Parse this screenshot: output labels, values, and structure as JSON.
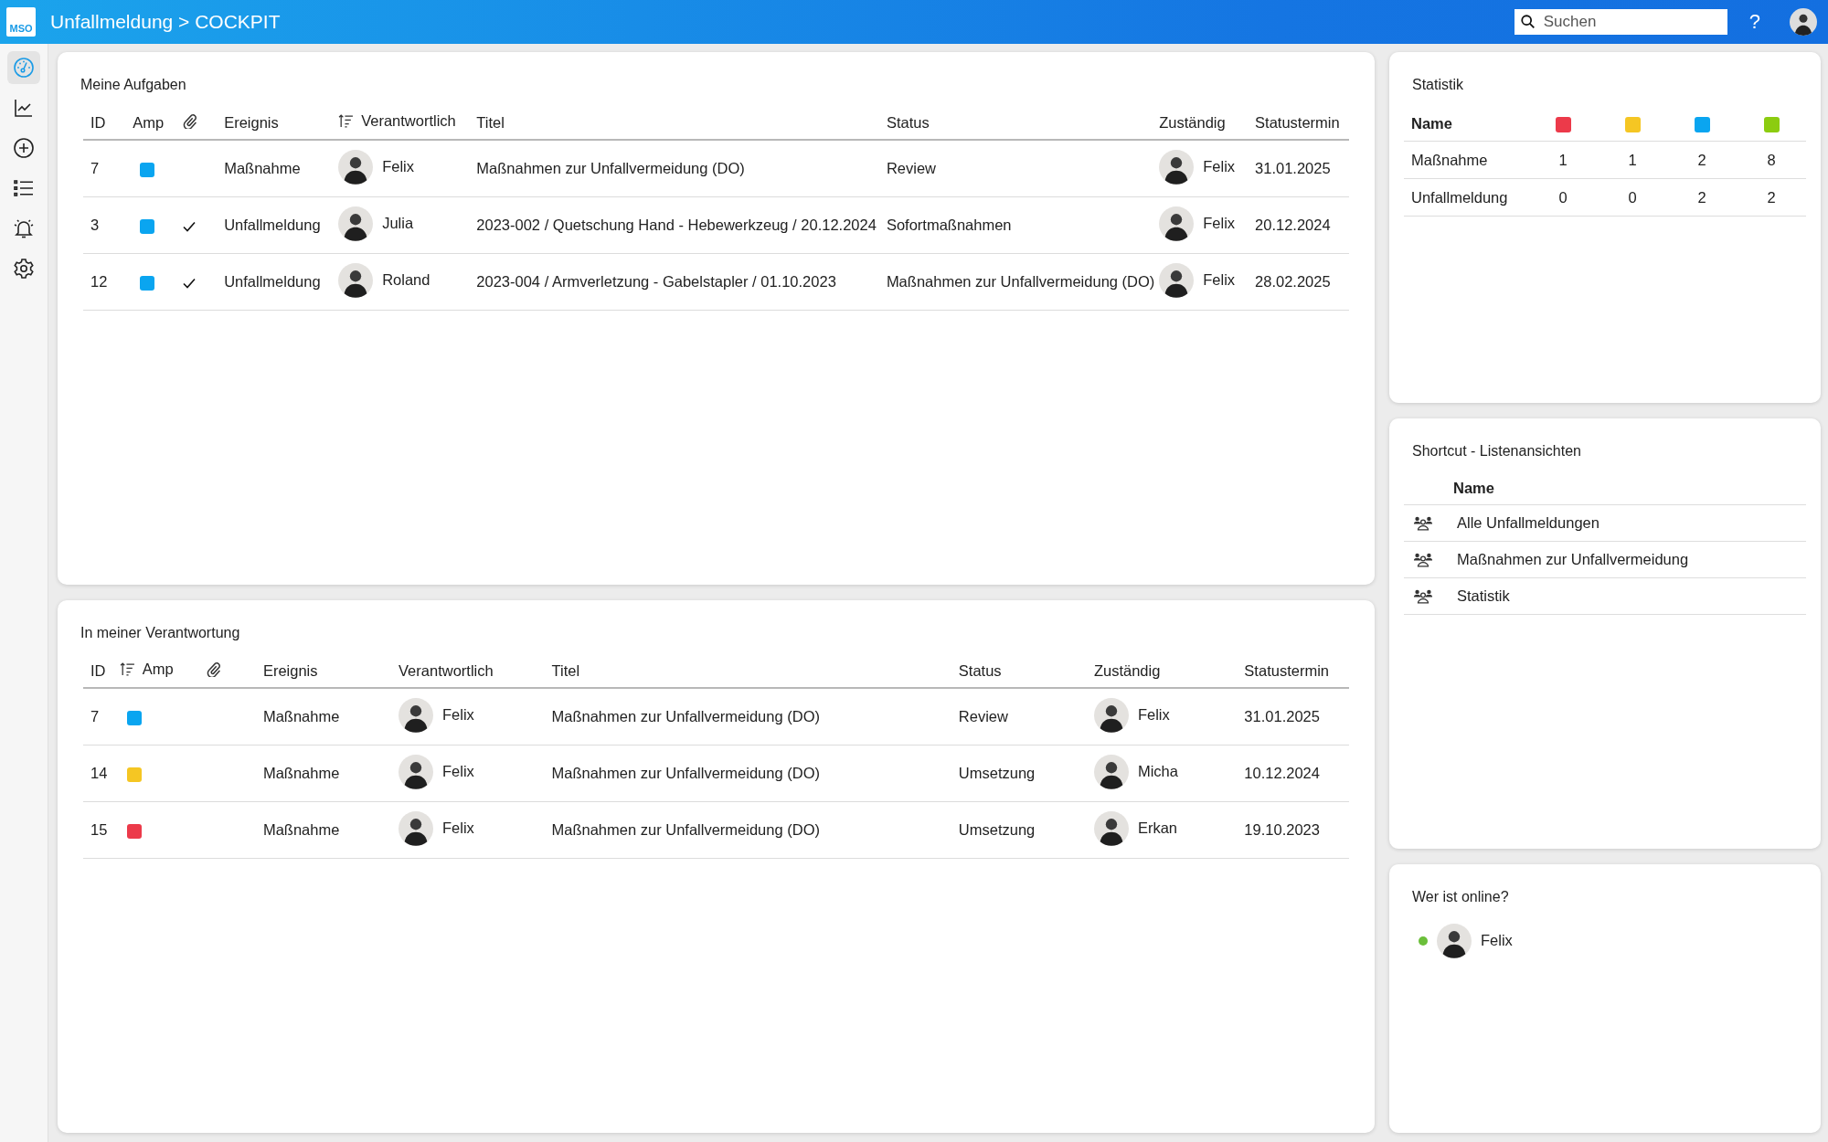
{
  "header": {
    "logo": "MSO",
    "title": "Unfallmeldung > COCKPIT",
    "search": {
      "placeholder": "Suchen"
    },
    "help": "?"
  },
  "sidebar": {
    "items": [
      {
        "kind": "gauge",
        "selected": true
      },
      {
        "kind": "chart",
        "selected": false
      },
      {
        "kind": "add",
        "selected": false
      },
      {
        "kind": "list",
        "selected": false
      },
      {
        "kind": "bell",
        "selected": false
      },
      {
        "kind": "settings",
        "selected": false
      }
    ]
  },
  "task_tables": [
    {
      "title": "Meine Aufgaben",
      "columns": [
        {
          "label": "ID",
          "sorted": false
        },
        {
          "label": "Amp",
          "sorted": false
        },
        {
          "kind": "attachment",
          "sorted": false
        },
        {
          "label": "Ereignis",
          "sorted": false
        },
        {
          "label": "Verantwortlich",
          "sorted": true
        },
        {
          "label": "Titel",
          "sorted": false
        },
        {
          "label": "Status",
          "sorted": false
        },
        {
          "label": "Zuständig",
          "sorted": false
        },
        {
          "label": "Statustermin",
          "sorted": false
        }
      ],
      "rows": [
        {
          "id": "7",
          "color": "#0aa5f0",
          "attachment": false,
          "event": "Maßnahme",
          "responsible": "Felix",
          "title": "Maßnahmen zur Unfallvermeidung (DO)",
          "status": "Review",
          "assignee": "Felix",
          "due": "31.01.2025"
        },
        {
          "id": "3",
          "color": "#0aa5f0",
          "attachment": true,
          "event": "Unfallmeldung",
          "responsible": "Julia",
          "title": "2023-002 / Quetschung Hand - Hebewerkzeug / 20.12.2024",
          "status": "Sofortmaßnahmen",
          "assignee": "Felix",
          "due": "20.12.2024"
        },
        {
          "id": "12",
          "color": "#0aa5f0",
          "attachment": true,
          "event": "Unfallmeldung",
          "responsible": "Roland",
          "title": "2023-004 / Armverletzung - Gabelstapler / 01.10.2023",
          "status": "Maßnahmen zur Unfallvermeidung (DO)",
          "assignee": "Felix",
          "due": "28.02.2025"
        }
      ]
    },
    {
      "title": "In meiner Verantwortung",
      "columns": [
        {
          "label": "ID",
          "sorted": false
        },
        {
          "label": "Amp",
          "sorted": true
        },
        {
          "kind": "attachment",
          "sorted": false
        },
        {
          "label": "Ereignis",
          "sorted": false
        },
        {
          "label": "Verantwortlich",
          "sorted": false
        },
        {
          "label": "Titel",
          "sorted": false
        },
        {
          "label": "Status",
          "sorted": false
        },
        {
          "label": "Zuständig",
          "sorted": false
        },
        {
          "label": "Statustermin",
          "sorted": false
        }
      ],
      "rows": [
        {
          "id": "7",
          "color": "#0aa5f0",
          "attachment": false,
          "event": "Maßnahme",
          "responsible": "Felix",
          "title": "Maßnahmen zur Unfallvermeidung (DO)",
          "status": "Review",
          "assignee": "Felix",
          "due": "31.01.2025"
        },
        {
          "id": "14",
          "color": "#f5c623",
          "attachment": false,
          "event": "Maßnahme",
          "responsible": "Felix",
          "title": "Maßnahmen zur Unfallvermeidung (DO)",
          "status": "Umsetzung",
          "assignee": "Micha",
          "due": "10.12.2024"
        },
        {
          "id": "15",
          "color": "#ec3a4a",
          "attachment": false,
          "event": "Maßnahme",
          "responsible": "Felix",
          "title": "Maßnahmen zur Unfallvermeidung (DO)",
          "status": "Umsetzung",
          "assignee": "Erkan",
          "due": "19.10.2023"
        }
      ]
    }
  ],
  "statistics": {
    "title": "Statistik",
    "name_header": "Name",
    "columns": [
      {
        "color": "#ec3a4a"
      },
      {
        "color": "#f5c623"
      },
      {
        "color": "#0aa5f0"
      },
      {
        "color": "#8ccc10"
      }
    ],
    "rows": [
      {
        "name": "Maßnahme",
        "values": [
          "1",
          "1",
          "2",
          "8"
        ]
      },
      {
        "name": "Unfallmeldung",
        "values": [
          "0",
          "0",
          "2",
          "2"
        ]
      }
    ]
  },
  "shortcuts": {
    "title": "Shortcut - Listenansichten",
    "name_header": "Name",
    "items": [
      "Alle Unfallmeldungen",
      "Maßnahmen zur Unfallvermeidung",
      "Statistik"
    ]
  },
  "online": {
    "title": "Wer ist online?",
    "users": [
      {
        "name": "Felix",
        "online": true
      }
    ]
  }
}
